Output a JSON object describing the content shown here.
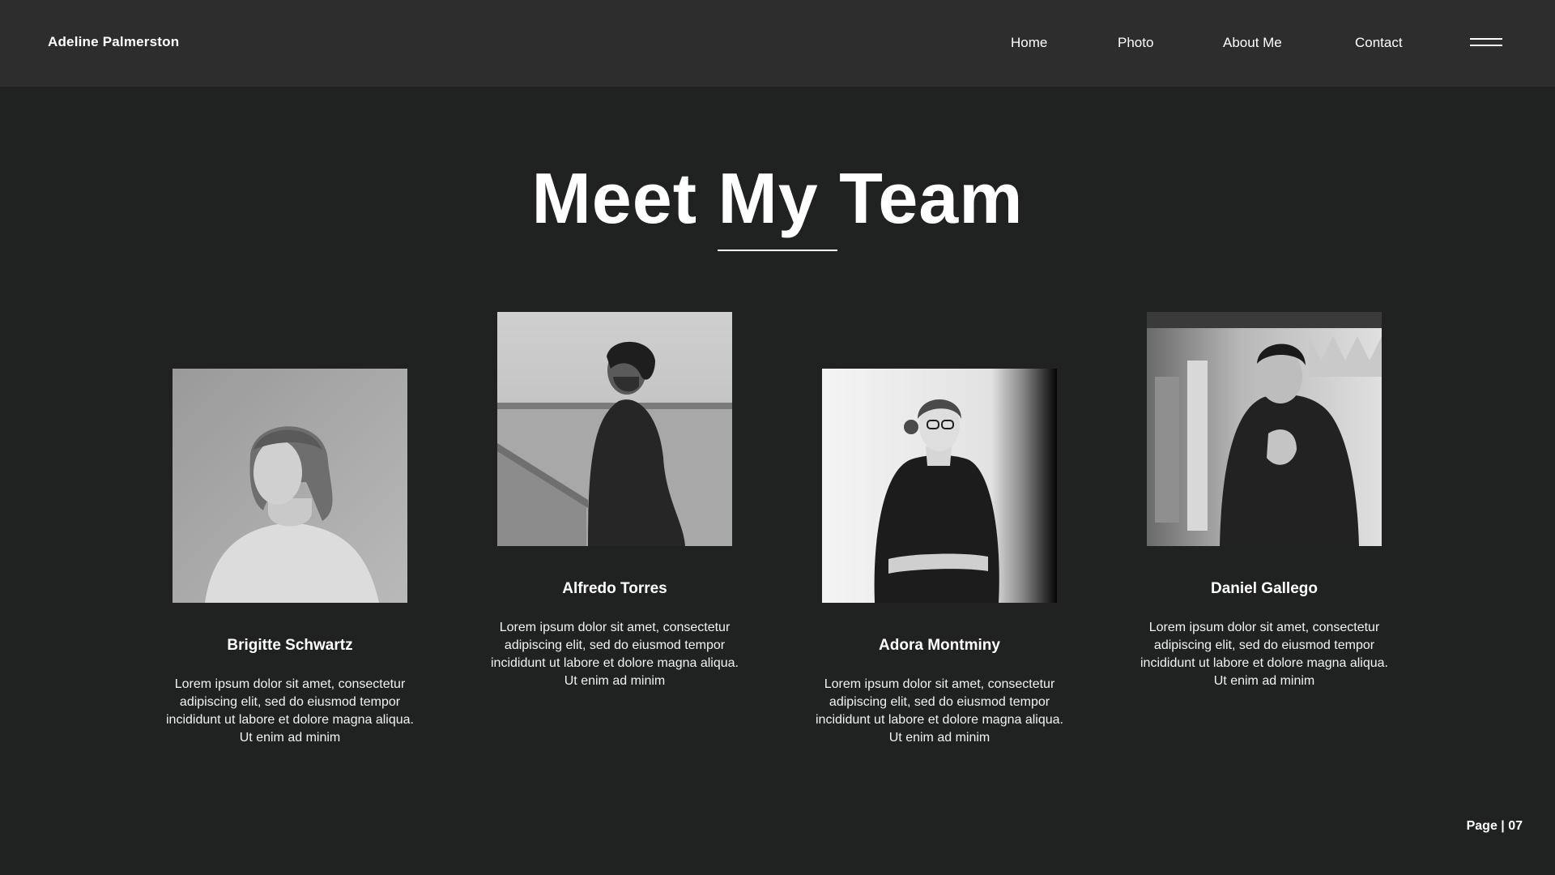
{
  "header": {
    "brand": "Adeline Palmerston",
    "nav": [
      {
        "label": "Home"
      },
      {
        "label": "Photo"
      },
      {
        "label": "About Me"
      },
      {
        "label": "Contact"
      }
    ],
    "menu_icon": "hamburger-icon"
  },
  "main": {
    "title": "Meet My Team",
    "team": [
      {
        "name": "Brigitte Schwartz",
        "description": "Lorem ipsum dolor sit amet, consectetur adipiscing elit, sed do eiusmod tempor incididunt ut labore et dolore magna aliqua. Ut enim ad minim"
      },
      {
        "name": "Alfredo Torres",
        "description": "Lorem ipsum dolor sit amet, consectetur adipiscing elit, sed do eiusmod tempor incididunt ut labore et dolore magna aliqua. Ut enim ad minim"
      },
      {
        "name": "Adora Montminy",
        "description": "Lorem ipsum dolor sit amet, consectetur adipiscing elit, sed do eiusmod tempor incididunt ut labore et dolore magna aliqua. Ut enim ad minim"
      },
      {
        "name": "Daniel Gallego",
        "description": "Lorem ipsum dolor sit amet, consectetur adipiscing elit, sed do eiusmod tempor incididunt ut labore et dolore magna aliqua. Ut enim ad minim"
      }
    ]
  },
  "footer": {
    "page_label": "Page | 07"
  },
  "colors": {
    "background": "#202221",
    "header_background": "#2d2d2d",
    "text": "#ffffff"
  }
}
